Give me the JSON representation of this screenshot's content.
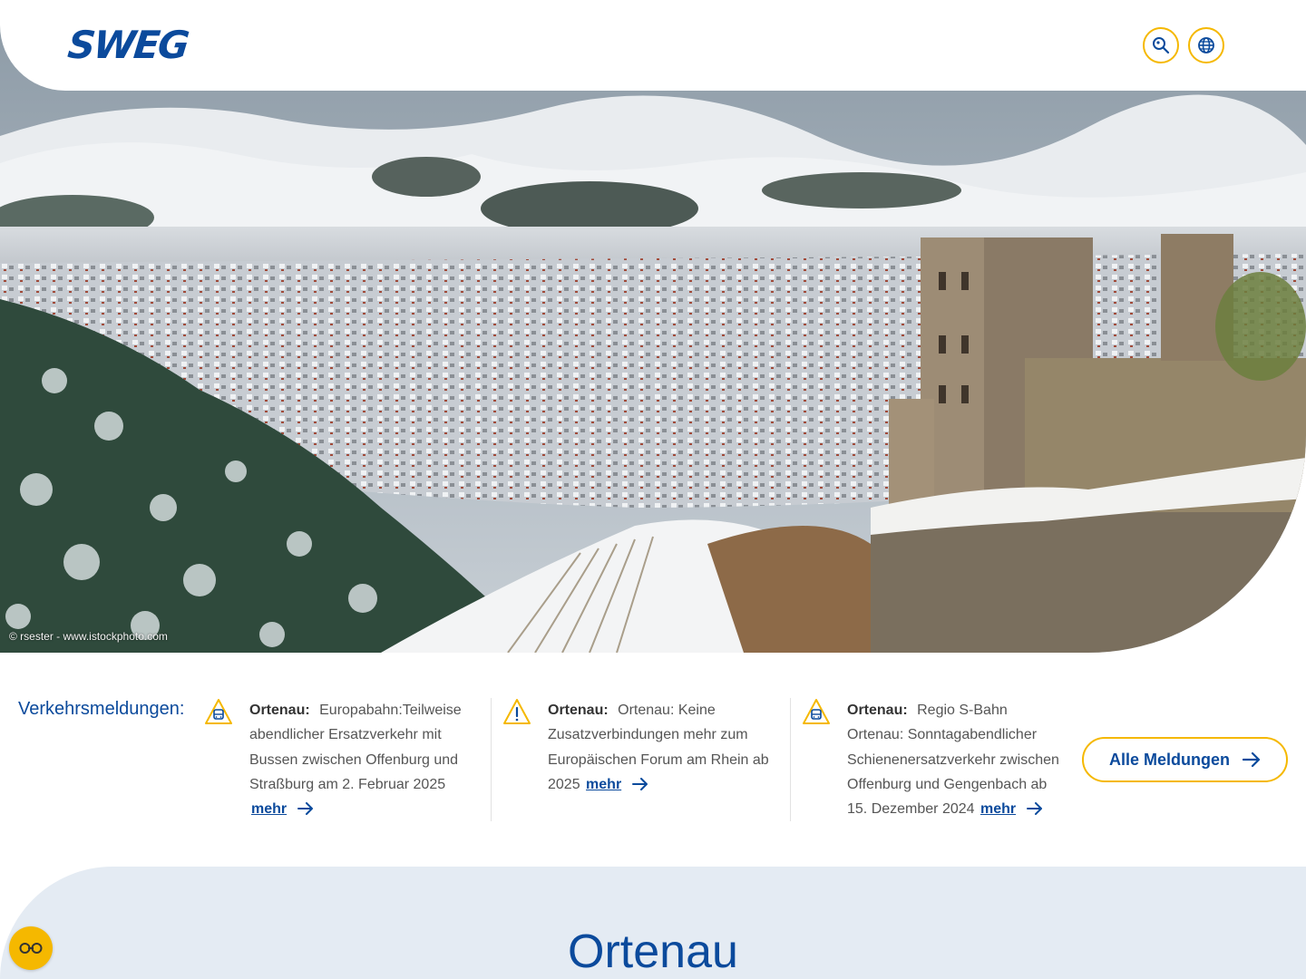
{
  "header": {
    "logo_text": "SWEG",
    "search_icon": "search-icon",
    "language_icon": "globe-icon"
  },
  "hero": {
    "photo_credit": "© rsester - www.istockphoto.com"
  },
  "traffic": {
    "label": "Verkehrsmeldungen:",
    "notices": [
      {
        "icon": "bus-warning-icon",
        "region": "Ortenau:",
        "text": "Europabahn:Teilweise abendlicher Ersatzverkehr mit Bussen zwischen Offenburg und Straßburg am 2. Februar 2025",
        "more": "mehr"
      },
      {
        "icon": "exclamation-warning-icon",
        "region": "Ortenau:",
        "text": "Ortenau: Keine Zusatzverbindungen mehr zum Europäischen Forum am Rhein ab 2025",
        "more": "mehr"
      },
      {
        "icon": "bus-warning-icon",
        "region": "Ortenau:",
        "text": "Regio S-Bahn Ortenau: Sonntagabendlicher Schienenersatzverkehr zwischen Offenburg und Gengenbach ab 15. Dezember 2024",
        "more": "mehr"
      }
    ],
    "all_button": "Alle Meldungen"
  },
  "region": {
    "title": "Ortenau"
  },
  "cookie": {
    "icon": "cookie-settings-icon"
  },
  "colors": {
    "brand_blue": "#0b4a9c",
    "accent_yellow": "#f5b800",
    "section_bg": "#e4ebf3"
  }
}
